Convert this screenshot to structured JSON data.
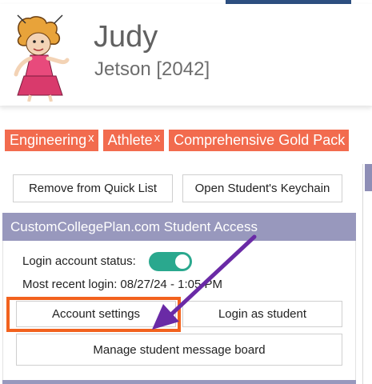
{
  "student": {
    "first_name": "Judy",
    "last_name_id": "Jetson [2042]"
  },
  "tags": [
    {
      "label": "Engineering",
      "remove": "x"
    },
    {
      "label": "Athlete",
      "remove": "x"
    },
    {
      "label": "Comprehensive Gold Pack",
      "remove": ""
    }
  ],
  "actions": {
    "remove_quick_list": "Remove from Quick List",
    "open_keychain": "Open Student's Keychain"
  },
  "student_access": {
    "title": "CustomCollegePlan.com Student Access",
    "login_status_label": "Login account status:",
    "login_status_on": true,
    "recent_login_label": "Most recent login:",
    "recent_login_value": "08/27/24 - 1:05 PM",
    "account_settings": "Account settings",
    "login_as_student": "Login as student",
    "manage_message_board": "Manage student message board"
  },
  "colors": {
    "tag": "#f26b4e",
    "section_header": "#9898bd",
    "toggle_on": "#2aa88e",
    "highlight": "#f2621e",
    "arrow": "#6a2aa6",
    "top_accent": "#2d4f80"
  },
  "icons": {
    "avatar": "cartoon-character-avatar",
    "arrow": "annotation-arrow"
  }
}
